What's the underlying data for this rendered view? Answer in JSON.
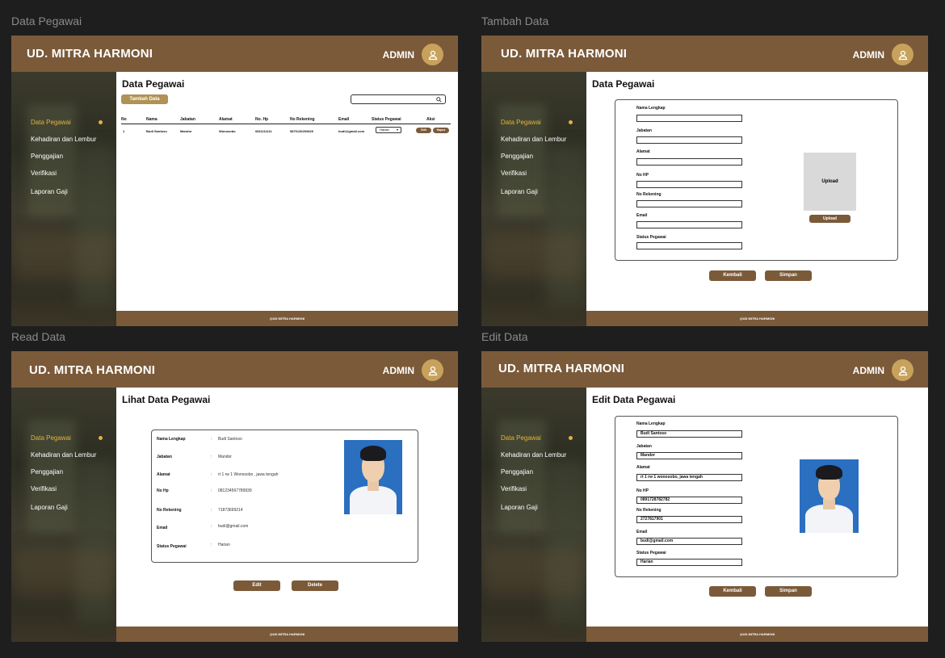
{
  "frames": {
    "list": {
      "label": "Data Pegawai",
      "heading": "Data Pegawai",
      "add_button": "Tambah Data",
      "table": {
        "headers": [
          "No",
          "Nama",
          "Jabatan",
          "Alamat",
          "No. Hp",
          "No Rekening",
          "Email",
          "Status Pegawai",
          "Aksi"
        ],
        "row": {
          "no": "1",
          "nama": "Budi Santoso",
          "jabatan": "Mandor",
          "alamat": "Wonosobo",
          "hp": "0811111111",
          "rekening": "5870136292826",
          "email": "budi@gmail.com",
          "status": "Harian",
          "edit": "Edit",
          "delete": "Hapus"
        }
      }
    },
    "add": {
      "label": "Tambah Data",
      "heading": "Data Pegawai",
      "fields": [
        "Nama Lengkap",
        "Jabatan",
        "Alamat",
        "No HP",
        "No Rekening",
        "Email",
        "Status Pegawai"
      ],
      "upload_placeholder": "Upload",
      "upload_button": "Upload",
      "back_button": "Kembali",
      "save_button": "Simpan"
    },
    "read": {
      "label": "Read Data",
      "heading": "Lihat Data Pegawai",
      "rows": [
        {
          "label": "Nama Lengkap",
          "value": "Budi Santoso"
        },
        {
          "label": "Jabatan",
          "value": "Mandor"
        },
        {
          "label": "Alamat",
          "value": "rt 1 rw 1 Wonosobo , jawa tengah"
        },
        {
          "label": "No Hp",
          "value": "081234567789939"
        },
        {
          "label": "No Rekening",
          "value": "71873699214"
        },
        {
          "label": "Email",
          "value": "budi@gmail.com"
        },
        {
          "label": "Status Pegawai",
          "value": "Harian"
        }
      ],
      "separator": ":",
      "edit_button": "Edit",
      "delete_button": "Delete"
    },
    "edit": {
      "label": "Edit Data",
      "heading": "Edit Data Pegawai",
      "fields": [
        {
          "label": "Nama Lengkap",
          "value": "Budi Santoso"
        },
        {
          "label": "Jabatan",
          "value": "Mandor"
        },
        {
          "label": "Alamat",
          "value": "rt 1 rw 1 wonosobo, jawa tengah"
        },
        {
          "label": "No HP",
          "value": "0891728782782"
        },
        {
          "label": "No Rekening",
          "value": "2727817901"
        },
        {
          "label": "Email",
          "value": "budi@gmail.com"
        },
        {
          "label": "Status Pegawai",
          "value": "Harian"
        }
      ],
      "back_button": "Kembali",
      "save_button": "Simpan"
    }
  },
  "common": {
    "brand": "UD. MITRA HARMONI",
    "admin": "ADMIN",
    "footer": "@UD MITRA HARMONI",
    "nav": [
      "Data Pegawai",
      "Kehadiran dan Lembur",
      "Penggajian",
      "Verifikasi",
      "Laporan Gaji"
    ]
  },
  "colors": {
    "brown": "#7b5a3a",
    "gold": "#c8a25c",
    "active_nav": "#e3b23c"
  }
}
